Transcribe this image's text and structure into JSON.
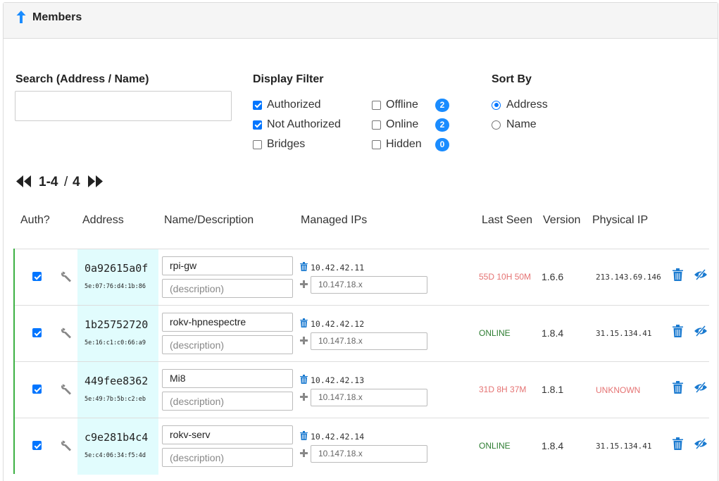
{
  "header": {
    "title": "Members",
    "arrow_icon": "arrow-up-icon"
  },
  "search": {
    "label": "Search (Address / Name)",
    "value": "",
    "placeholder": ""
  },
  "display_filter": {
    "label": "Display Filter",
    "options": [
      {
        "label": "Authorized",
        "checked": true
      },
      {
        "label": "Not Authorized",
        "checked": true
      },
      {
        "label": "Bridges",
        "checked": false
      },
      {
        "label": "Offline",
        "checked": false,
        "count": "2"
      },
      {
        "label": "Online",
        "checked": false,
        "count": "2"
      },
      {
        "label": "Hidden",
        "checked": false,
        "count": "0"
      }
    ]
  },
  "sort_by": {
    "label": "Sort By",
    "options": [
      {
        "label": "Address",
        "selected": true
      },
      {
        "label": "Name",
        "selected": false
      }
    ]
  },
  "pager": {
    "range": "1-4",
    "separator": "/",
    "total": "4",
    "prev_icon": "double-chevron-left-icon",
    "next_icon": "double-chevron-right-icon"
  },
  "columns": [
    "Auth?",
    "Address",
    "Name/Description",
    "Managed IPs",
    "Last Seen",
    "Version",
    "Physical IP"
  ],
  "colors": {
    "accent": "#1a8cff",
    "online": "#2e7d32",
    "offline": "#e57373",
    "unknown": "#e57373",
    "authorized_border": "#3cb043",
    "address_bg": "#e1fcfd"
  },
  "members": [
    {
      "authorized": true,
      "address": "0a92615a0f",
      "mac": "5e:07:76:d4:1b:86",
      "name": "rpi-gw",
      "description_placeholder": "(description)",
      "ip": "10.42.42.11",
      "ip_placeholder": "10.147.18.x",
      "last_seen": "55D 10H 50M",
      "last_seen_status": "offline",
      "version": "1.6.6",
      "physical_ip": "213.143.69.146",
      "physical_status": "known"
    },
    {
      "authorized": true,
      "address": "1b25752720",
      "mac": "5e:16:c1:c0:66:a9",
      "name": "rokv-hpnespectre",
      "description_placeholder": "(description)",
      "ip": "10.42.42.12",
      "ip_placeholder": "10.147.18.x",
      "last_seen": "ONLINE",
      "last_seen_status": "online",
      "version": "1.8.4",
      "physical_ip": "31.15.134.41",
      "physical_status": "known"
    },
    {
      "authorized": true,
      "address": "449fee8362",
      "mac": "5e:49:7b:5b:c2:eb",
      "name": "Mi8",
      "description_placeholder": "(description)",
      "ip": "10.42.42.13",
      "ip_placeholder": "10.147.18.x",
      "last_seen": "31D 8H 37M",
      "last_seen_status": "offline",
      "version": "1.8.1",
      "physical_ip": "UNKNOWN",
      "physical_status": "unknown"
    },
    {
      "authorized": true,
      "address": "c9e281b4c4",
      "mac": "5e:c4:06:34:f5:4d",
      "name": "rokv-serv",
      "description_placeholder": "(description)",
      "ip": "10.42.42.14",
      "ip_placeholder": "10.147.18.x",
      "last_seen": "ONLINE",
      "last_seen_status": "online",
      "version": "1.8.4",
      "physical_ip": "31.15.134.41",
      "physical_status": "known"
    }
  ]
}
